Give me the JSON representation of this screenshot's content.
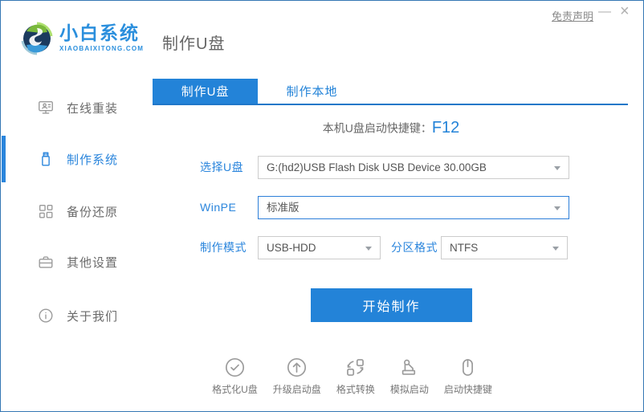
{
  "window_controls": {
    "disclaimer": "免责声明",
    "minimize": "—",
    "close": "×"
  },
  "header": {
    "logo_title": "小白系统",
    "logo_subtitle": "XIAOBAIXITONG.COM",
    "page_title": "制作U盘"
  },
  "sidebar": {
    "items": [
      {
        "label": "在线重装",
        "icon": "online-reinstall-icon",
        "active": false
      },
      {
        "label": "制作系统",
        "icon": "usb-make-system-icon",
        "active": true
      },
      {
        "label": "备份还原",
        "icon": "backup-restore-icon",
        "active": false
      },
      {
        "label": "其他设置",
        "icon": "other-settings-icon",
        "active": false
      },
      {
        "label": "关于我们",
        "icon": "about-us-icon",
        "active": false
      }
    ]
  },
  "tabs": [
    {
      "label": "制作U盘",
      "active": true
    },
    {
      "label": "制作本地",
      "active": false
    }
  ],
  "main": {
    "hotkey_label": "本机U盘启动快捷键：",
    "hotkey_value": "F12",
    "fields": {
      "usb_label": "选择U盘",
      "usb_value": "G:(hd2)USB Flash Disk USB Device 30.00GB",
      "winpe_label": "WinPE",
      "winpe_value": "标准版",
      "mode_label": "制作模式",
      "mode_value": "USB-HDD",
      "partition_label": "分区格式",
      "partition_value": "NTFS"
    },
    "start_button": "开始制作"
  },
  "footer": {
    "tools": [
      {
        "label": "格式化U盘",
        "icon": "format-usb-icon"
      },
      {
        "label": "升级启动盘",
        "icon": "upgrade-boot-disk-icon"
      },
      {
        "label": "格式转换",
        "icon": "format-convert-icon"
      },
      {
        "label": "模拟启动",
        "icon": "simulate-boot-icon"
      },
      {
        "label": "启动快捷键",
        "icon": "boot-hotkey-icon"
      }
    ]
  },
  "colors": {
    "accent_blue": "#2383d8",
    "label_blue": "#2a85dc",
    "window_border": "#3577b4",
    "text_gray": "#666666",
    "icon_gray": "#9b9b9b"
  }
}
